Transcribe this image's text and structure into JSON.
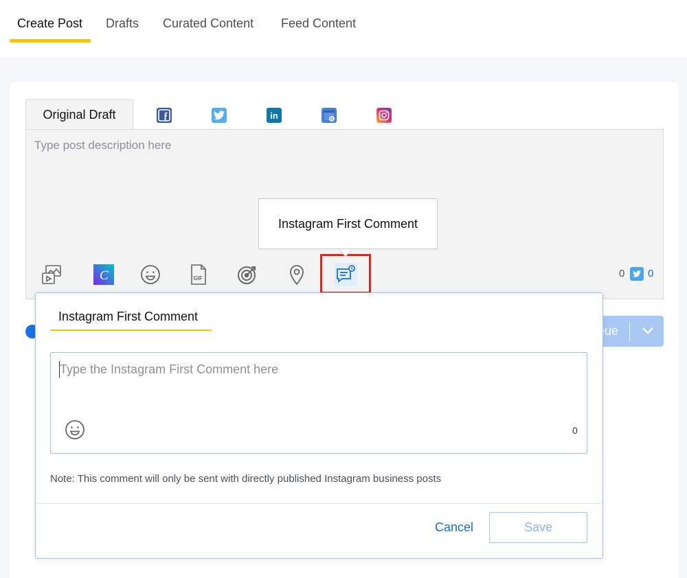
{
  "top_tabs": [
    {
      "label": "Create Post",
      "active": true
    },
    {
      "label": "Drafts",
      "active": false
    },
    {
      "label": "Curated Content",
      "active": false
    },
    {
      "label": "Feed Content",
      "active": false
    }
  ],
  "composer": {
    "active_tab": "Original Draft",
    "networks": [
      "facebook-icon",
      "twitter-icon",
      "linkedin-icon",
      "google-business-icon",
      "instagram-icon"
    ],
    "placeholder": "Type post description here",
    "toolbar": [
      "media-library-icon",
      "canva-icon",
      "emoji-icon",
      "gif-icon",
      "target-icon",
      "location-icon",
      "instagram-first-comment-icon"
    ],
    "tooltip": "Instagram First Comment",
    "count_left": "0",
    "count_twitter": "0"
  },
  "queue_button": {
    "label": "eue"
  },
  "first_comment_popup": {
    "tab_label": "Instagram First Comment",
    "placeholder": "Type the Instagram First Comment here",
    "char_count": "0",
    "note": "Note: This comment will only be sent with directly published Instagram business posts",
    "cancel_label": "Cancel",
    "save_label": "Save"
  },
  "colors": {
    "accent_yellow": "#f7c600",
    "primary_blue": "#1a6fcf",
    "highlight_red": "#e0261b"
  }
}
